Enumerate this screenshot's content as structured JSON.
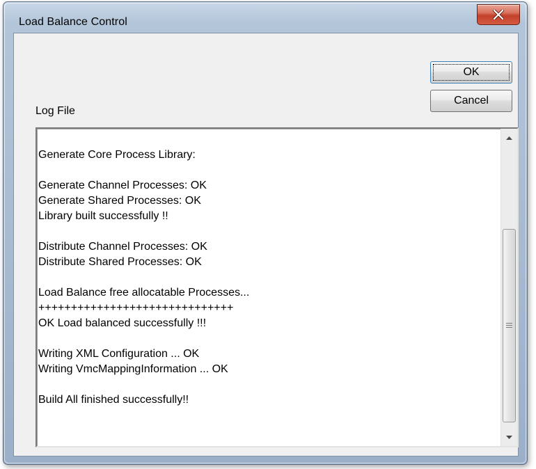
{
  "window": {
    "title": "Load Balance Control"
  },
  "buttons": {
    "ok_label": "OK",
    "cancel_label": "Cancel"
  },
  "log": {
    "label": "Log File",
    "lines": [
      "Generate Core Process Library:",
      "",
      "Generate Channel Processes: OK",
      "Generate Shared Processes: OK",
      "Library built successfully !!",
      "",
      "Distribute Channel Processes: OK",
      "Distribute Shared Processes: OK",
      "",
      "Load Balance free allocatable Processes...",
      "++++++++++++++++++++++++++++++",
      "OK Load balanced successfully !!!",
      "",
      "Writing XML Configuration ... OK",
      "Writing VmcMappingInformation ... OK",
      "",
      "Build All finished successfully!!"
    ]
  },
  "icons": {
    "close": "close-icon",
    "scroll_up": "scroll-up-arrow-icon",
    "scroll_down": "scroll-down-arrow-icon",
    "grip": "scroll-grip-icon"
  },
  "colors": {
    "close_button": "#c2402b",
    "dialog_background": "#f0f0f0",
    "frame": "#b3c5d9"
  }
}
